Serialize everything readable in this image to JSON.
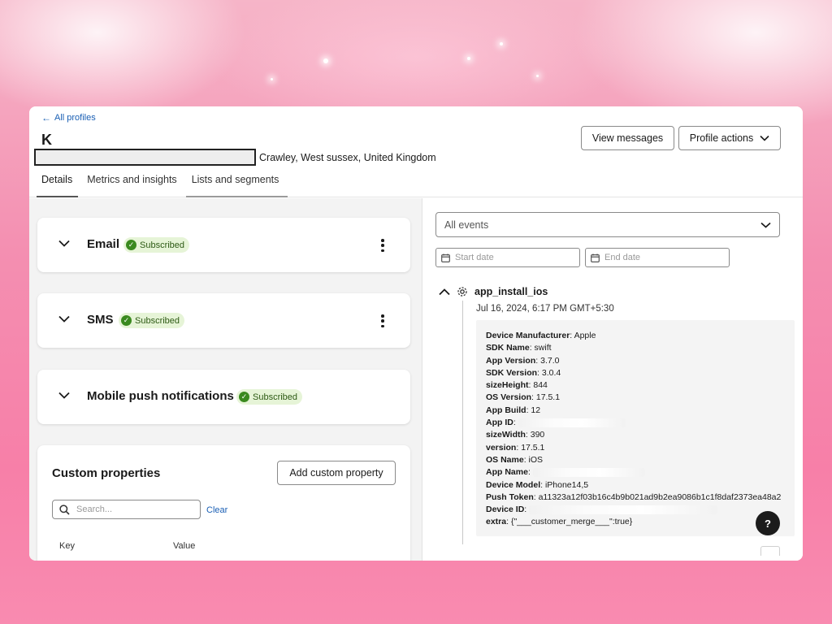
{
  "header": {
    "back_link": "All profiles",
    "profile_name": "K",
    "location": "Crawley, West sussex, United Kingdom",
    "view_messages": "View messages",
    "profile_actions": "Profile actions"
  },
  "tabs": [
    {
      "label": "Details"
    },
    {
      "label": "Metrics and insights"
    },
    {
      "label": "Lists and segments"
    }
  ],
  "channels": [
    {
      "title": "Email",
      "status": "Subscribed"
    },
    {
      "title": "SMS",
      "status": "Subscribed"
    },
    {
      "title": "Mobile push notifications",
      "status": "Subscribed"
    }
  ],
  "custom_properties": {
    "title": "Custom properties",
    "add_button": "Add custom property",
    "search_placeholder": "Search...",
    "clear": "Clear",
    "col_key": "Key",
    "col_value": "Value"
  },
  "events": {
    "filter": "All events",
    "start_placeholder": "Start date",
    "end_placeholder": "End date",
    "event_name": "app_install_ios",
    "event_time": "Jul 16, 2024, 6:17 PM GMT+5:30",
    "properties": [
      {
        "key": "Device Manufacturer",
        "value": "Apple"
      },
      {
        "key": "SDK Name",
        "value": "swift"
      },
      {
        "key": "App Version",
        "value": "3.7.0"
      },
      {
        "key": "SDK Version",
        "value": "3.0.4"
      },
      {
        "key": "sizeHeight",
        "value": "844"
      },
      {
        "key": "OS Version",
        "value": "17.5.1"
      },
      {
        "key": "App Build",
        "value": "12"
      },
      {
        "key": "App ID",
        "value": ""
      },
      {
        "key": "sizeWidth",
        "value": "390"
      },
      {
        "key": "version",
        "value": "17.5.1"
      },
      {
        "key": "OS Name",
        "value": "iOS"
      },
      {
        "key": "App Name",
        "value": ""
      },
      {
        "key": "Device Model",
        "value": "iPhone14,5"
      },
      {
        "key": "Push Token",
        "value": "a11323a12f03b16c4b9b021ad9b2ea9086b1c1f8daf2373ea48a2"
      },
      {
        "key": "Device ID",
        "value": ""
      },
      {
        "key": "extra",
        "value": "{\"___customer_merge___\":true}"
      }
    ]
  },
  "help": "?",
  "colors": {
    "accent_link": "#1a5fb4",
    "badge_bg": "#e6f4d7",
    "badge_check": "#3a8a1f"
  }
}
